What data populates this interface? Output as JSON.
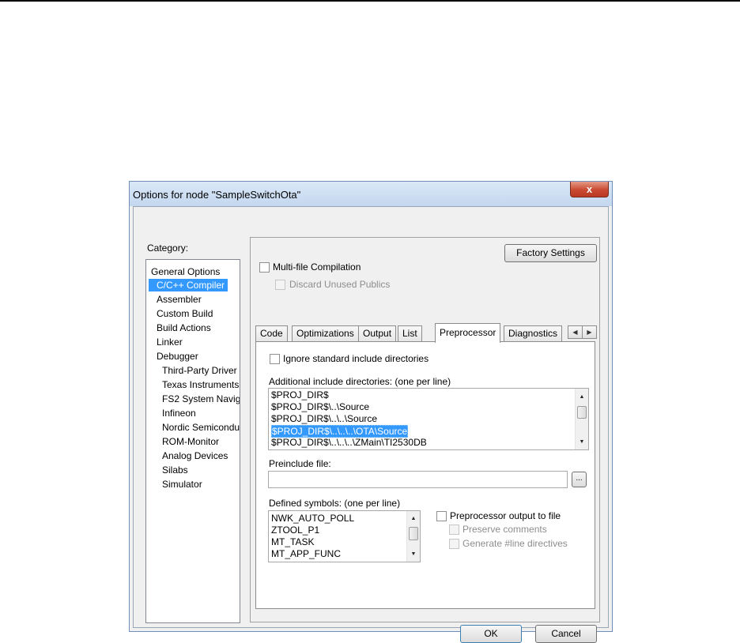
{
  "window": {
    "title": "Options for node \"SampleSwitchOta\"",
    "close_glyph": "x"
  },
  "category": {
    "label": "Category:",
    "items": [
      {
        "label": "General Options"
      },
      {
        "label": "C/C++ Compiler"
      },
      {
        "label": "Assembler"
      },
      {
        "label": "Custom Build"
      },
      {
        "label": "Build Actions"
      },
      {
        "label": "Linker"
      },
      {
        "label": "Debugger"
      },
      {
        "label": "Third-Party Driver"
      },
      {
        "label": "Texas Instruments"
      },
      {
        "label": "FS2 System Naviga"
      },
      {
        "label": "Infineon"
      },
      {
        "label": "Nordic Semiconduc"
      },
      {
        "label": "ROM-Monitor"
      },
      {
        "label": "Analog Devices"
      },
      {
        "label": "Silabs"
      },
      {
        "label": "Simulator"
      }
    ],
    "selected_index": 1
  },
  "panel": {
    "factory_settings": "Factory Settings",
    "multi_file": {
      "label": "Multi-file Compilation",
      "checked": false
    },
    "discard_unused": {
      "label": "Discard Unused Publics",
      "checked": false,
      "enabled": false
    },
    "tabs": [
      "Code",
      "Optimizations",
      "Output",
      "List",
      "Preprocessor",
      "Diagnostics"
    ],
    "active_tab": "Preprocessor",
    "tab_scroll_left": "◀",
    "tab_scroll_right": "▶"
  },
  "preprocessor": {
    "ignore_std": {
      "label": "Ignore standard include directories",
      "checked": false
    },
    "include_label": "Additional include directories: (one per line)",
    "include_lines": [
      "$PROJ_DIR$",
      "$PROJ_DIR$\\..\\Source",
      "$PROJ_DIR$\\..\\..\\Source",
      "$PROJ_DIR$\\..\\..\\..\\OTA\\Source",
      "$PROJ_DIR$\\..\\..\\..\\ZMain\\TI2530DB"
    ],
    "include_selected_index": 3,
    "preinclude_label": "Preinclude file:",
    "preinclude_value": "",
    "browse_label": "...",
    "defined_label": "Defined symbols: (one per line)",
    "defined_lines": [
      "NWK_AUTO_POLL",
      "ZTOOL_P1",
      "MT_TASK",
      "MT_APP_FUNC"
    ],
    "pp_output": {
      "label": "Preprocessor output to file",
      "checked": false
    },
    "preserve_comments": {
      "label": "Preserve comments",
      "checked": false,
      "enabled": false
    },
    "line_directives": {
      "label": "Generate #line directives",
      "checked": false,
      "enabled": false
    }
  },
  "buttons": {
    "ok": "OK",
    "cancel": "Cancel"
  },
  "scroll": {
    "up": "▲",
    "down": "▼"
  },
  "colors": {
    "selection": "#3399ff",
    "close_button": "#c94a31",
    "title_bar": "#c3d7ef"
  }
}
